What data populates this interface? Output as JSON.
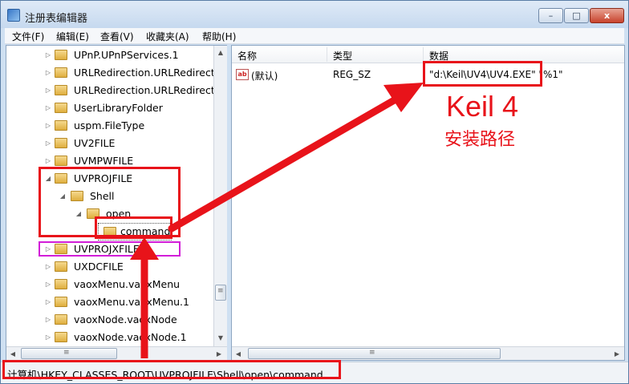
{
  "window": {
    "title": "注册表编辑器",
    "controls": {
      "minimize": "–",
      "maximize": "□",
      "close": "x"
    }
  },
  "menu": [
    "文件(F)",
    "编辑(E)",
    "查看(V)",
    "收藏夹(A)",
    "帮助(H)"
  ],
  "tree": {
    "items": [
      {
        "label": "UPnP.UPnPServices.1",
        "expander": "▷"
      },
      {
        "label": "URLRedirection.URLRedirect",
        "expander": "▷"
      },
      {
        "label": "URLRedirection.URLRedirect",
        "expander": "▷"
      },
      {
        "label": "UserLibraryFolder",
        "expander": "▷"
      },
      {
        "label": "uspm.FileType",
        "expander": "▷"
      },
      {
        "label": "UV2FILE",
        "expander": "▷"
      },
      {
        "label": "UVMPWFILE",
        "expander": "▷"
      },
      {
        "label": "UVPROJFILE",
        "expander": "◢"
      },
      {
        "label": "Shell",
        "expander": "◢"
      },
      {
        "label": "open",
        "expander": "◢"
      },
      {
        "label": "command",
        "expander": ""
      },
      {
        "label": "UVPROJXFILE",
        "expander": "▷"
      },
      {
        "label": "UXDCFILE",
        "expander": "▷"
      },
      {
        "label": "vaoxMenu.vaoxMenu",
        "expander": "▷"
      },
      {
        "label": "vaoxMenu.vaoxMenu.1",
        "expander": "▷"
      },
      {
        "label": "vaoxNode.vaoxNode",
        "expander": "▷"
      },
      {
        "label": "vaoxNode.vaoxNode.1",
        "expander": "▷"
      }
    ],
    "scroll": {
      "up": "▲",
      "down": "▼",
      "left": "◀",
      "right": "▶",
      "thumb": "≡"
    }
  },
  "list": {
    "columns": [
      "名称",
      "类型",
      "数据"
    ],
    "rows": [
      {
        "name": "(默认)",
        "type": "REG_SZ",
        "data": "\"d:\\Keil\\UV4\\UV4.EXE\" \"%1\"",
        "icon": "ab-icon"
      }
    ],
    "icon_text": "ab"
  },
  "status": {
    "path": "计算机\\HKEY_CLASSES_ROOT\\UVPROJFILE\\Shell\\open\\command"
  },
  "annotation": {
    "title": "Keil 4",
    "subtitle": "安装路径"
  },
  "colors": {
    "annotation_red": "#e8131a",
    "highlight_pink": "#d21ed8",
    "window_frame": "#cfe0f2"
  }
}
